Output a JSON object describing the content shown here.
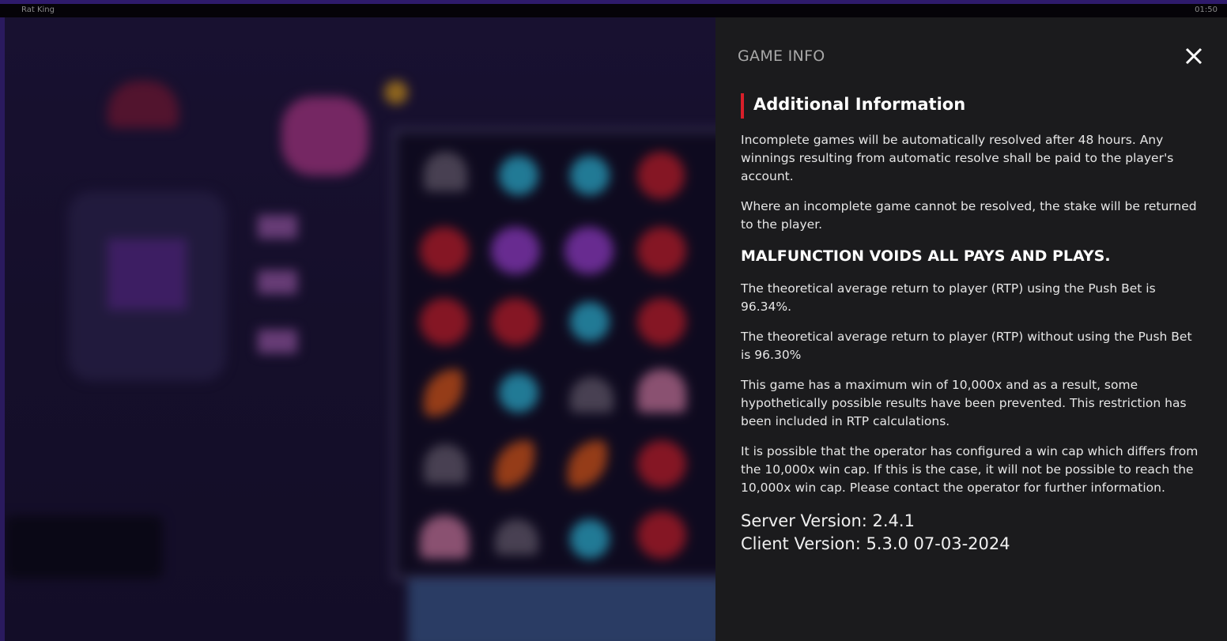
{
  "window": {
    "title": "Rat King",
    "clock": "01:50"
  },
  "panel": {
    "title": "GAME INFO",
    "close_icon": "close-icon",
    "section_heading": "Additional Information",
    "paragraphs": [
      "Incomplete games will be automatically resolved after 48 hours. Any winnings resulting from automatic resolve shall be paid to the player's account.",
      "Where an incomplete game cannot be resolved, the stake will be returned to the player."
    ],
    "warning": "MALFUNCTION VOIDS ALL PAYS AND PLAYS.",
    "rtp_paragraphs": [
      "The theoretical average return to player (RTP) using the Push Bet is 96.34%.",
      "The theoretical average return to player (RTP) without using the Push Bet is 96.30%",
      "This game has a maximum win of 10,000x and as a result, some hypothetically possible results have been prevented. This restriction has been included in RTP calculations.",
      "It is possible that the operator has configured a win cap which differs from the 10,000x win cap. If this is the case, it will not be possible to reach the 10,000x win cap. Please contact the operator for further information."
    ],
    "server_version": "Server Version: 2.4.1",
    "client_version": "Client Version: 5.3.0 07-03-2024"
  },
  "colors": {
    "accent_bar": "#d81f2a",
    "panel_bg": "#1b1b1d",
    "game_bg": "#21173d"
  }
}
